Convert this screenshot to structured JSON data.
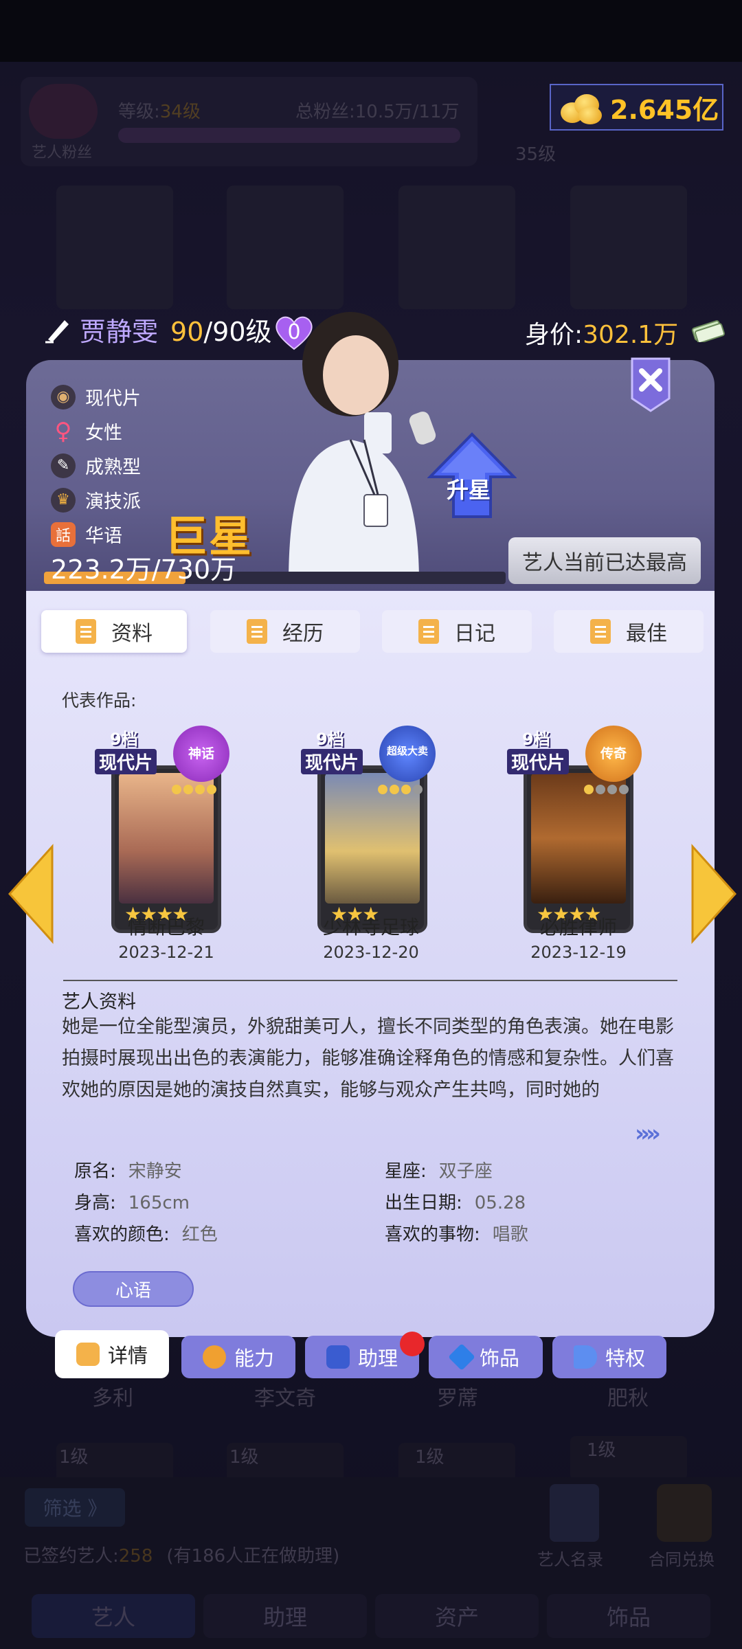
{
  "background": {
    "fan_label": "艺人粉丝",
    "level_label": "等级:",
    "level_value": "34级",
    "fans_label": "总粉丝:",
    "fans_value": "10.5万/11万",
    "badge_level": "35级",
    "artist_names": [
      "多利",
      "李文奇",
      "罗蓆",
      "肥秋"
    ],
    "filter_button": "筛选 》",
    "signed_label": "已签约艺人:",
    "signed_count": "258",
    "signed_note": "(有186人正在做助理)",
    "catalog_label": "艺人名录",
    "exchange_label": "合同兑换",
    "bottom_tabs": [
      "艺人",
      "助理",
      "资产",
      "饰品"
    ],
    "card_levels": [
      "1级",
      "1级",
      "1级",
      "1级"
    ]
  },
  "header": {
    "coins": "2.645亿"
  },
  "artist": {
    "name": "贾静雯",
    "level_current": "90",
    "level_max": "/90级",
    "hearts": "0",
    "price_label": "身价:",
    "price_value": "302.1万",
    "traits": [
      {
        "icon": "film-reel-icon",
        "label": "现代片"
      },
      {
        "icon": "female-icon",
        "label": "女性"
      },
      {
        "icon": "brush-icon",
        "label": "成熟型"
      },
      {
        "icon": "oscar-icon",
        "label": "演技派"
      },
      {
        "icon": "chinese-icon",
        "label": "华语"
      }
    ],
    "rank_title": "巨星",
    "exp_text": "223.2万/730万",
    "exp_fraction": 0.306,
    "upgrade_label": "升星",
    "max_status": "艺人当前已达最高"
  },
  "tabs": [
    {
      "label": "资料",
      "active": true
    },
    {
      "label": "经历",
      "active": false
    },
    {
      "label": "日记",
      "active": false
    },
    {
      "label": "最佳",
      "active": false
    }
  ],
  "works_label": "代表作品:",
  "works": [
    {
      "grade": "9档",
      "genre": "现代片",
      "award": "神话",
      "award_color": "#b54be0",
      "stars": "★★★★",
      "title": "情断巴黎",
      "date": "2023-12-21"
    },
    {
      "grade": "9档",
      "genre": "现代片",
      "award": "超级大卖",
      "award_color": "#3a63d8",
      "stars": "★★★",
      "title": "少林寺足球",
      "date": "2023-12-20"
    },
    {
      "grade": "9档",
      "genre": "现代片",
      "award": "传奇",
      "award_color": "#e8901c",
      "stars": "★★★★",
      "title": "必胜律师",
      "date": "2023-12-19"
    }
  ],
  "bio": {
    "heading": "艺人资料",
    "text": "她是一位全能型演员，外貌甜美可人，擅长不同类型的角色表演。她在电影拍摄时展现出出色的表演能力，能够准确诠释角色的情感和复杂性。人们喜欢她的原因是她的演技自然真实，能够与观众产生共鸣，同时她的",
    "more": "»»"
  },
  "details": {
    "real_name_label": "原名:",
    "real_name": "宋静安",
    "zodiac_label": "星座:",
    "zodiac": "双子座",
    "height_label": "身高:",
    "height": "165cm",
    "birthday_label": "出生日期:",
    "birthday": "05.28",
    "color_label": "喜欢的颜色:",
    "color": "红色",
    "hobby_label": "喜欢的事物:",
    "hobby": "唱歌"
  },
  "heart_words_button": "心语",
  "panel_tabs": [
    {
      "label": "详情",
      "active": true
    },
    {
      "label": "能力",
      "active": false
    },
    {
      "label": "助理",
      "active": false
    },
    {
      "label": "饰品",
      "active": false
    },
    {
      "label": "特权",
      "active": false
    }
  ],
  "colors": {
    "gold": "#ffc13b",
    "name_purple": "#bfa9ff",
    "panel_bg": "#dcdbf7",
    "tab_purple": "#7f7cdc"
  }
}
